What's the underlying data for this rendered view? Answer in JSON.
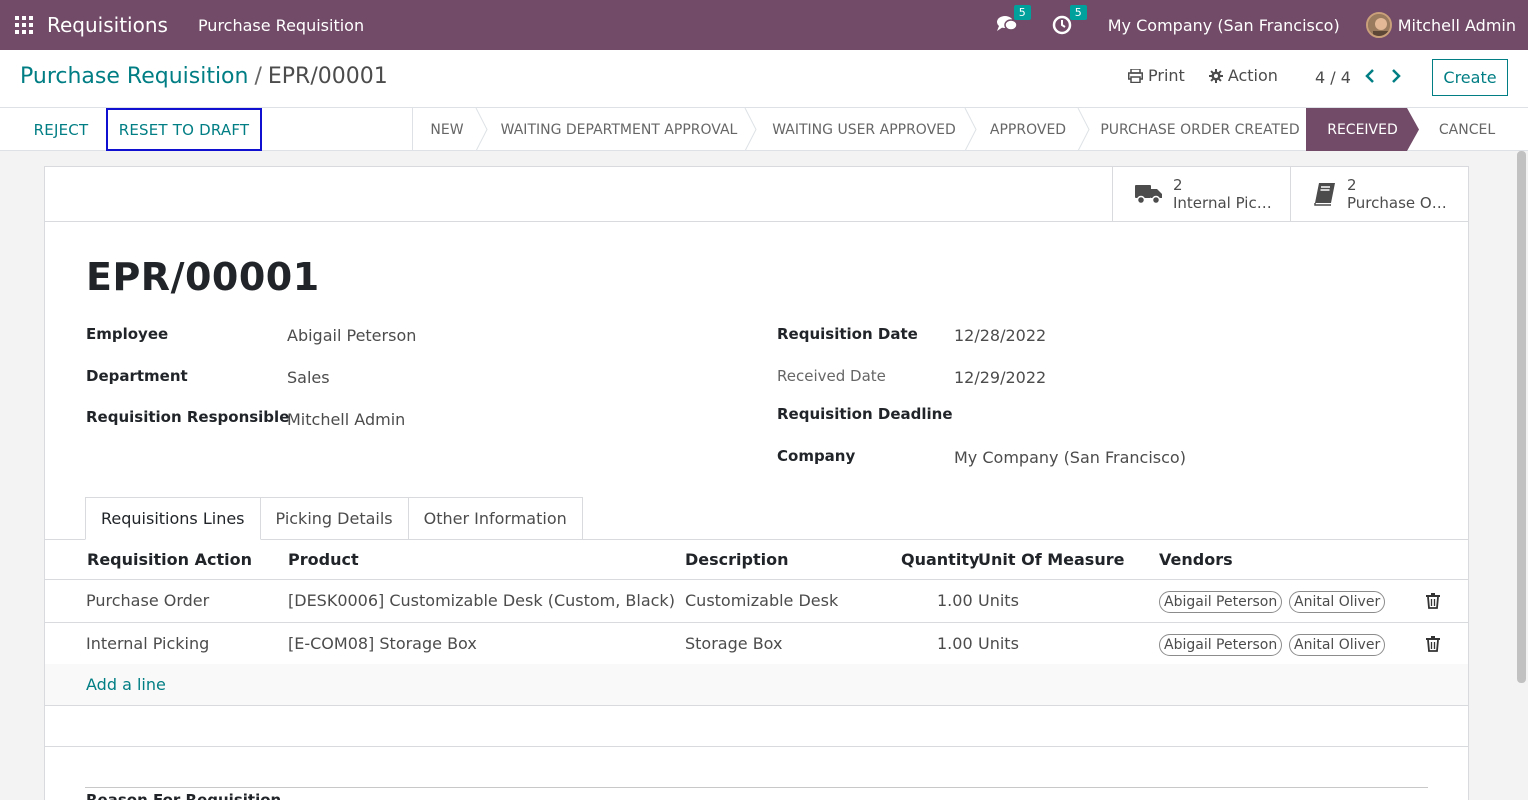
{
  "navbar": {
    "app_name": "Requisitions",
    "menu_item": "Purchase Requisition",
    "messages_count": "5",
    "activities_count": "5",
    "company": "My Company (San Francisco)",
    "user": "Mitchell Admin"
  },
  "control_panel": {
    "breadcrumb_parent": "Purchase Requisition",
    "breadcrumb_sep": "/",
    "breadcrumb_current": "EPR/00001",
    "print_label": "Print",
    "action_label": "Action",
    "pager": "4 / 4",
    "create_label": "Create"
  },
  "statusbar": {
    "reject_label": "REJECT",
    "reset_label": "RESET TO DRAFT",
    "stages": [
      "NEW",
      "WAITING DEPARTMENT APPROVAL",
      "WAITING USER APPROVED",
      "APPROVED",
      "PURCHASE ORDER CREATED",
      "RECEIVED",
      "CANCEL"
    ],
    "active_stage": "RECEIVED"
  },
  "smart_buttons": [
    {
      "count": "2",
      "label": "Internal Pic…",
      "icon": "truck-icon"
    },
    {
      "count": "2",
      "label": "Purchase O…",
      "icon": "book-icon"
    }
  ],
  "form": {
    "title": "EPR/00001",
    "employee_label": "Employee",
    "employee": "Abigail Peterson",
    "department_label": "Department",
    "department": "Sales",
    "responsible_label": "Requisition Responsible",
    "responsible": "Mitchell Admin",
    "req_date_label": "Requisition Date",
    "req_date": "12/28/2022",
    "received_date_label": "Received Date",
    "received_date": "12/29/2022",
    "deadline_label": "Requisition Deadline",
    "company_label": "Company",
    "company": "My Company (San Francisco)"
  },
  "tabs": [
    "Requisitions Lines",
    "Picking Details",
    "Other Information"
  ],
  "lines": {
    "headers": {
      "action": "Requisition Action",
      "product": "Product",
      "description": "Description",
      "quantity": "Quantity",
      "uom": "Unit Of Measure",
      "vendors": "Vendors"
    },
    "rows": [
      {
        "action": "Purchase Order",
        "product": "[DESK0006] Customizable Desk (Custom, Black)",
        "description": "Customizable Desk",
        "quantity": "1.00",
        "uom": "Units",
        "vendors": [
          "Abigail Peterson",
          "Anital Oliver"
        ]
      },
      {
        "action": "Internal Picking",
        "product": "[E-COM08] Storage Box",
        "description": "Storage Box",
        "quantity": "1.00",
        "uom": "Units",
        "vendors": [
          "Abigail Peterson",
          "Anital Oliver"
        ]
      }
    ],
    "add_line": "Add a line"
  },
  "reason_label": "Reason For Requisition",
  "colors": {
    "brand": "#714b67",
    "accent": "#017e84",
    "badge": "#00a09d"
  }
}
